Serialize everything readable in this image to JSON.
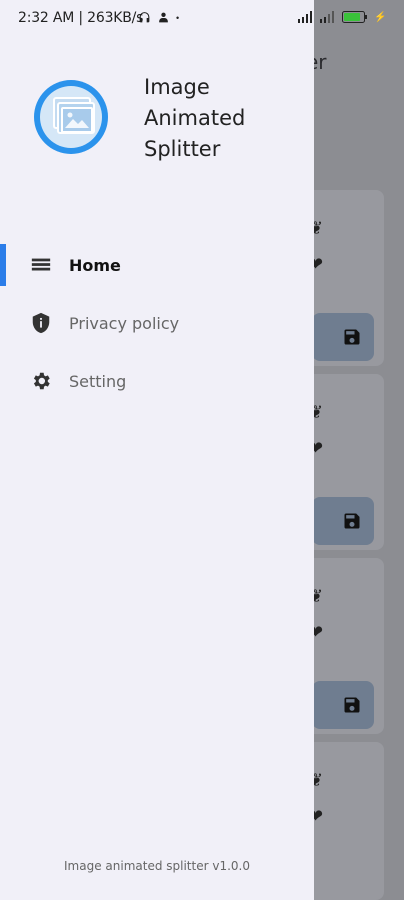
{
  "status_bar": {
    "time_speed": "2:32 AM | 263KB/s",
    "battery_level": "76"
  },
  "background_screen": {
    "title_fragment": "er"
  },
  "drawer": {
    "app_name": [
      "Image",
      "Animated",
      "Splitter"
    ],
    "menu": [
      {
        "label": "Home",
        "icon": "menu-lines-icon",
        "active": true
      },
      {
        "label": "Privacy policy",
        "icon": "shield-info-icon",
        "active": false
      },
      {
        "label": "Setting",
        "icon": "gear-icon",
        "active": false
      }
    ],
    "version": "Image animated splitter v1.0.0"
  },
  "colors": {
    "accent": "#2b7de9",
    "drawer_bg": "#f1f0f8",
    "scrim_bg": "#8c8d92",
    "logo_ring": "#2b93ec"
  }
}
